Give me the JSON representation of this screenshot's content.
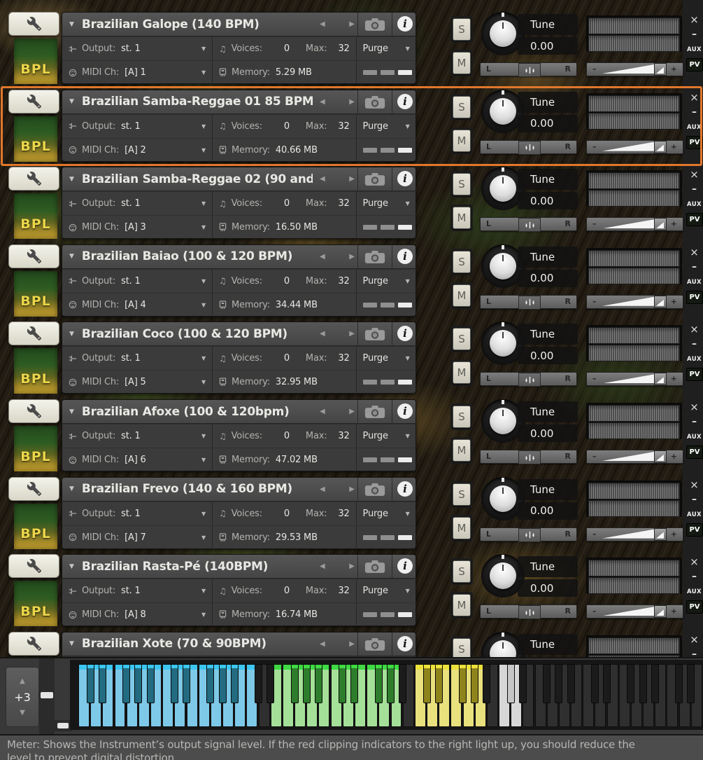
{
  "colors": {
    "selection": "#e0772c",
    "bpl_text": "#ead54a"
  },
  "labels": {
    "badge": "BPL",
    "collapse_caret": "▼",
    "dropdown_caret": "▼",
    "prev": "◀",
    "next": "▶",
    "info": "i",
    "output": "Output:",
    "voices": "Voices:",
    "max": "Max:",
    "midi": "MIDI Ch:",
    "memory": "Memory:",
    "purge": "Purge",
    "solo": "S",
    "mute": "M",
    "tune": "Tune",
    "pan_left": "L",
    "pan_right": "R",
    "vol_minus": "–",
    "vol_plus": "+",
    "close": "×",
    "minimize": "–",
    "aux": "AUX",
    "pv": "PV",
    "voices_icon": "♫",
    "transpose_up": "▲",
    "transpose_down": "▼"
  },
  "slots": [
    {
      "title": "Brazilian Galope (140 BPM)",
      "output": "st. 1",
      "voices": "0",
      "max": "32",
      "midi_ch": "[A] 1",
      "memory": "5.29 MB",
      "tune": "0.00",
      "selected": false
    },
    {
      "title": "Brazilian Samba-Reggae 01 85 BPM",
      "output": "st. 1",
      "voices": "0",
      "max": "32",
      "midi_ch": "[A] 2",
      "memory": "40.66 MB",
      "tune": "0.00",
      "selected": true
    },
    {
      "title": "Brazilian Samba-Reggae 02 (90 and",
      "output": "st. 1",
      "voices": "0",
      "max": "32",
      "midi_ch": "[A] 3",
      "memory": "16.50 MB",
      "tune": "0.00",
      "selected": false
    },
    {
      "title": "Brazilian Baiao (100 & 120 BPM)",
      "output": "st. 1",
      "voices": "0",
      "max": "32",
      "midi_ch": "[A] 4",
      "memory": "34.44 MB",
      "tune": "0.00",
      "selected": false
    },
    {
      "title": "Brazilian Coco (100 & 120 BPM)",
      "output": "st. 1",
      "voices": "0",
      "max": "32",
      "midi_ch": "[A] 5",
      "memory": "32.95 MB",
      "tune": "0.00",
      "selected": false
    },
    {
      "title": "Brazilian Afoxe (100 & 120bpm)",
      "output": "st. 1",
      "voices": "0",
      "max": "32",
      "midi_ch": "[A] 6",
      "memory": "47.02 MB",
      "tune": "0.00",
      "selected": false
    },
    {
      "title": "Brazilian Frevo (140 & 160 BPM)",
      "output": "st. 1",
      "voices": "0",
      "max": "32",
      "midi_ch": "[A] 7",
      "memory": "29.53 MB",
      "tune": "0.00",
      "selected": false
    },
    {
      "title": "Brazilian Rasta-Pé (140BPM)",
      "output": "st. 1",
      "voices": "0",
      "max": "32",
      "midi_ch": "[A] 8",
      "memory": "16.74 MB",
      "tune": "0.00",
      "selected": false
    },
    {
      "title": "Brazilian Xote (70 & 90BPM)",
      "output": "",
      "voices": "",
      "max": "",
      "midi_ch": "",
      "memory": "",
      "tune": "Tune",
      "selected": false
    }
  ],
  "keyboard": {
    "transpose": "+3",
    "white_key_count": 52,
    "sections": [
      {
        "from": 0,
        "to": 14,
        "color": "blue"
      },
      {
        "from": 16,
        "to": 26,
        "color": "green"
      },
      {
        "from": 28,
        "to": 33,
        "color": "yellow"
      },
      {
        "from": 35,
        "to": 36,
        "color": "gray"
      }
    ],
    "palette": {
      "blue": {
        "white": "#7ec9e8",
        "black": "#226b80",
        "cap": "#3cc6f2"
      },
      "green": {
        "white": "#a5e098",
        "black": "#2e7d2c",
        "cap": "#3fd944"
      },
      "yellow": {
        "white": "#e9e07e",
        "black": "#8f831c",
        "cap": "#ece23c"
      },
      "gray": {
        "white": "#d7d7d7",
        "black": "#c6c6c6",
        "cap": ""
      },
      "dark": {
        "white": "#2f2f2f",
        "black": "#1b1b1b",
        "cap": ""
      }
    }
  },
  "status_bar": {
    "line1": "Meter: Shows the Instrument’s output signal level. If the red clipping indicators to the right light up, you should reduce the",
    "line2": "level to prevent digital distortion."
  }
}
